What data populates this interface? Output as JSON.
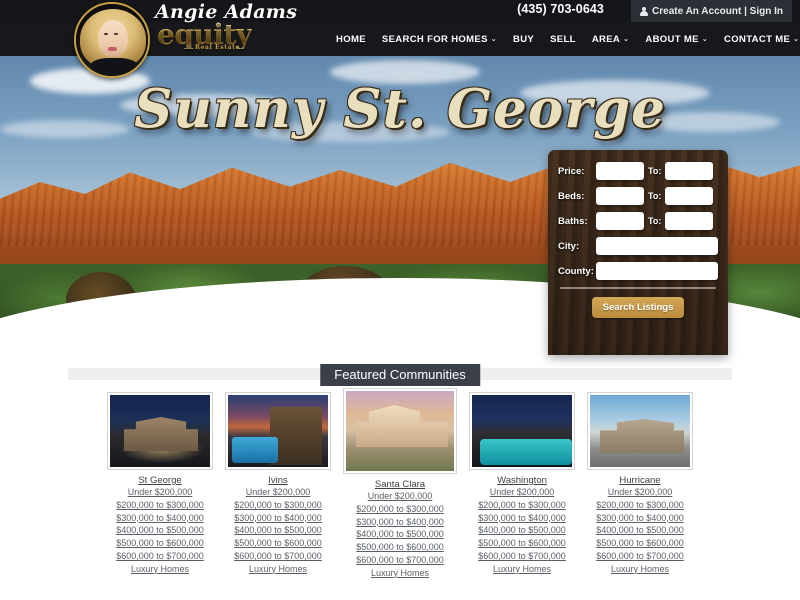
{
  "topbar": {
    "phone": "(435) 703-0643",
    "account_icon": "person-icon",
    "account_text": "Create An Account | Sign In"
  },
  "brand": {
    "agent_name": "Angie Adams",
    "company": "equity",
    "tagline": "Real Estate"
  },
  "nav": {
    "items": [
      {
        "label": "HOME",
        "caret": ""
      },
      {
        "label": "SEARCH FOR HOMES",
        "caret": "⌄"
      },
      {
        "label": "BUY",
        "caret": ""
      },
      {
        "label": "SELL",
        "caret": ""
      },
      {
        "label": "AREA",
        "caret": "⌄"
      },
      {
        "label": "ABOUT ME",
        "caret": "⌄"
      },
      {
        "label": "CONTACT ME",
        "caret": "⌄"
      }
    ]
  },
  "hero": {
    "title": "Sunny St. George"
  },
  "search": {
    "rows": [
      {
        "label": "Price:",
        "to": "To:"
      },
      {
        "label": "Beds:",
        "to": "To:"
      },
      {
        "label": "Baths:",
        "to": "To:"
      }
    ],
    "city_label": "City:",
    "county_label": "County:",
    "button": "Search Listings",
    "values": {
      "price_min": "",
      "price_max": "",
      "beds_min": "",
      "beds_max": "",
      "baths_min": "",
      "baths_max": "",
      "city": "",
      "county": ""
    }
  },
  "featured": {
    "heading": "Featured Communities",
    "cards": [
      {
        "name": "St George",
        "scene": "sc-stgeorge",
        "links": [
          "Under $200,000",
          "$200,000 to $300,000",
          "$300,000 to $400,000",
          "$400,000 to $500,000",
          "$500,000 to $600,000",
          "$600,000 to $700,000",
          "Luxury Homes"
        ]
      },
      {
        "name": "Ivins",
        "scene": "sc-ivins",
        "links": [
          "Under $200,000",
          "$200,000 to $300,000",
          "$300,000 to $400,000",
          "$400,000 to $500,000",
          "$500,000 to $600,000",
          "$600,000 to $700,000",
          "Luxury Homes"
        ]
      },
      {
        "name": "Santa Clara",
        "scene": "sc-santaclara",
        "links": [
          "Under $200,000",
          "$200,000 to $300,000",
          "$300,000 to $400,000",
          "$400,000 to $500,000",
          "$500,000 to $600,000",
          "$600,000 to $700,000",
          "Luxury Homes"
        ]
      },
      {
        "name": "Washington",
        "scene": "sc-washington",
        "links": [
          "Under $200,000",
          "$200,000 to $300,000",
          "$300,000 to $400,000",
          "$400,000 to $500,000",
          "$500,000 to $600,000",
          "$600,000 to $700,000",
          "Luxury Homes"
        ]
      },
      {
        "name": "Hurricane",
        "scene": "sc-hurricane",
        "links": [
          "Under $200,000",
          "$200,000 to $300,000",
          "$300,000 to $400,000",
          "$400,000 to $500,000",
          "$500,000 to $600,000",
          "$600,000 to $700,000",
          "Luxury Homes"
        ]
      }
    ]
  },
  "colors": {
    "header_dark": "#16181c",
    "gold": "#c79746",
    "badge_dark": "#3a3f48",
    "panel_wood": "#4a3422"
  }
}
